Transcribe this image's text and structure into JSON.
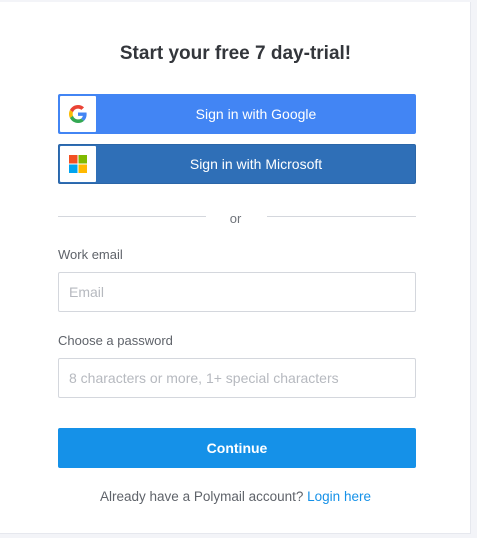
{
  "heading": "Start your free 7 day-trial!",
  "sso": {
    "google_label": "Sign in with Google",
    "google_icon": "google-g-icon",
    "google_color": "#4285f4",
    "microsoft_label": "Sign in with Microsoft",
    "microsoft_icon": "microsoft-logo-icon",
    "microsoft_color": "#2f6fb7"
  },
  "divider_text": "or",
  "email": {
    "label": "Work email",
    "value": "",
    "placeholder": "Email"
  },
  "password": {
    "label": "Choose a password",
    "value": "",
    "placeholder": "8 characters or more, 1+ special characters"
  },
  "continue_label": "Continue",
  "continue_color": "#1591e8",
  "footer": {
    "prompt": "Already have a Polymail account?",
    "link_label": "Login here"
  }
}
